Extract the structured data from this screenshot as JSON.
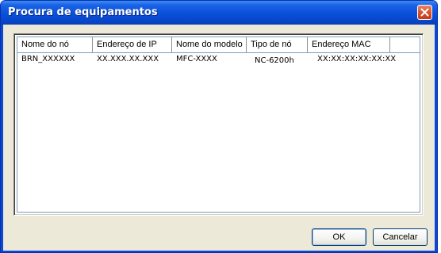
{
  "window": {
    "title": "Procura de equipamentos"
  },
  "list": {
    "columns": [
      "Nome do nó",
      "Endereço de IP",
      "Nome do modelo",
      "Tipo de nó",
      "Endereço MAC"
    ],
    "rows": [
      [
        "BRN_XXXXXX",
        "XX.XXX.XX.XXX",
        "MFC-XXXX",
        "NC-6200h",
        "XX:XX:XX:XX:XX:XX"
      ]
    ]
  },
  "buttons": {
    "ok_label": "OK",
    "cancel_label": "Cancelar"
  },
  "colors": {
    "titlebar": "#0a4fd9",
    "dialog_face": "#ece9d8",
    "close_button": "#d9542c"
  }
}
